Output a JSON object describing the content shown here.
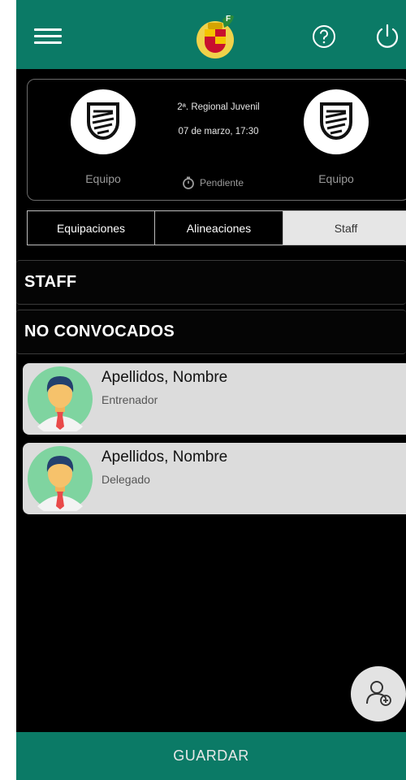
{
  "header": {
    "menu_icon": "hamburger-icon",
    "logo_icon": "federation-crest-icon",
    "help_icon": "help-circle-icon",
    "power_icon": "power-icon",
    "color": "#0b7a66"
  },
  "match": {
    "home_team": "Equipo",
    "away_team": "Equipo",
    "league": "2ª. Regional Juvenil",
    "datetime": "07 de marzo, 17:30",
    "status": "Pendiente",
    "team_icon": "team-shield-icon",
    "status_icon": "stopwatch-icon"
  },
  "tabs": [
    {
      "label": "Equipaciones"
    },
    {
      "label": "Alineaciones"
    },
    {
      "label": "Staff",
      "selected": true
    }
  ],
  "sections": {
    "staff": "STAFF",
    "no_convocados": "NO CONVOCADOS"
  },
  "staff_list": [
    {
      "name": "Apellidos, Nombre",
      "role": "Entrenador"
    },
    {
      "name": "Apellidos, Nombre",
      "role": "Delegado"
    }
  ],
  "fab_icon": "add-person-icon",
  "footer": {
    "save_label": "GUARDAR"
  }
}
